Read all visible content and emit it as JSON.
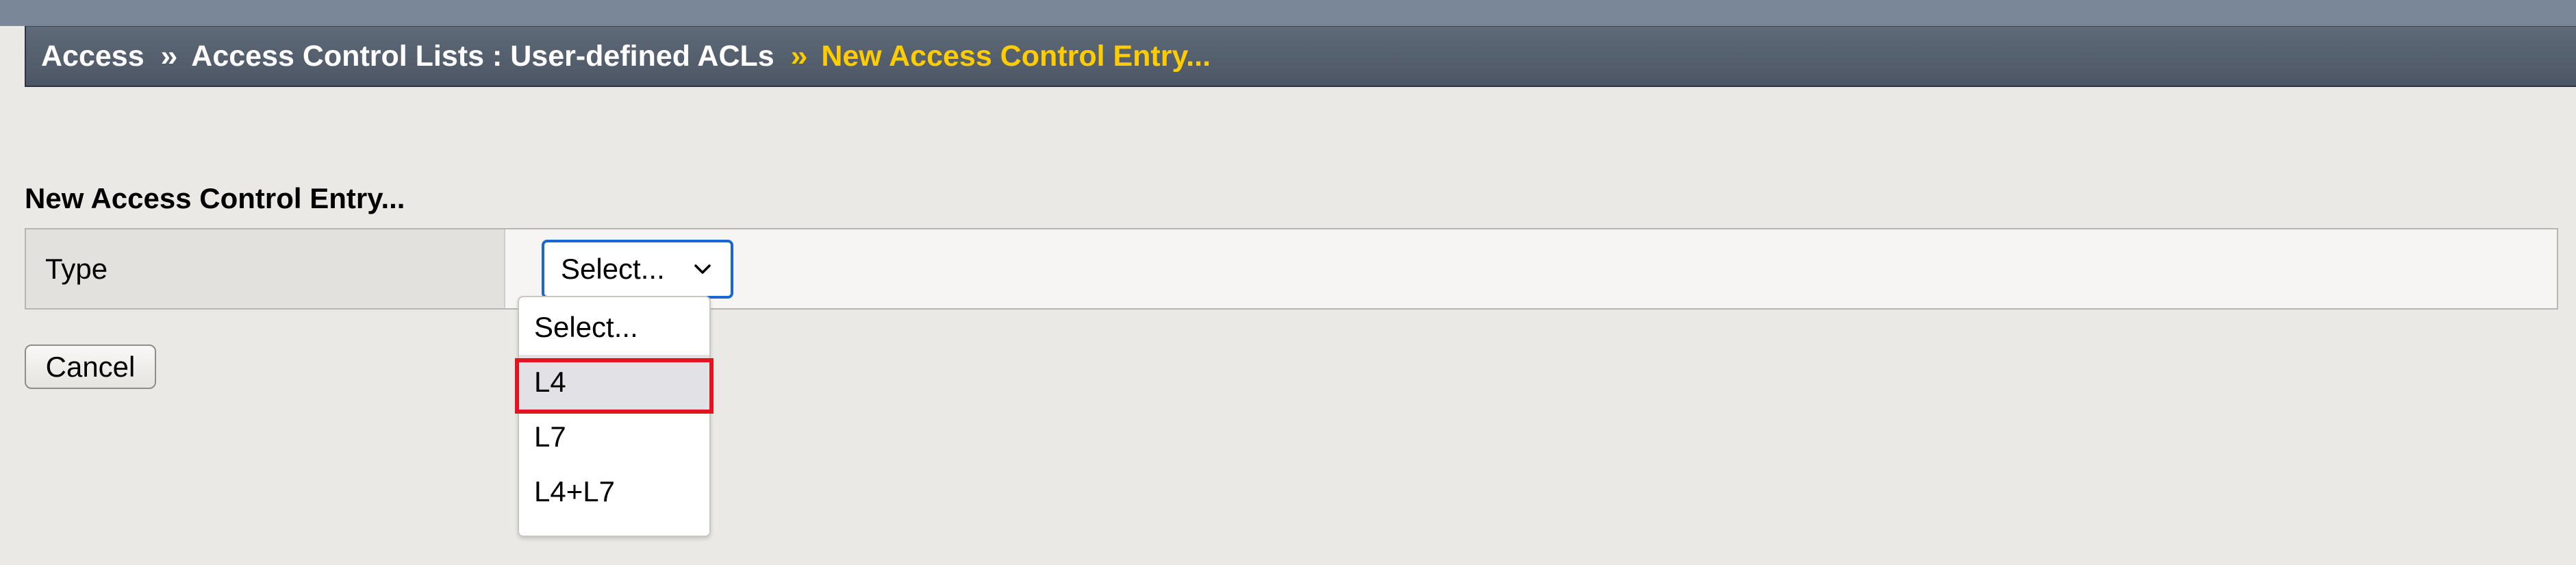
{
  "breadcrumb": {
    "items": [
      "Access",
      "Access Control Lists : User-defined ACLs"
    ],
    "separator": "››",
    "current": "New Access Control Entry..."
  },
  "form": {
    "title": "New Access Control Entry...",
    "type_label": "Type",
    "type_select": {
      "selected": "Select...",
      "options": [
        "Select...",
        "L4",
        "L7",
        "L4+L7"
      ],
      "highlighted_option": "L4"
    }
  },
  "buttons": {
    "cancel": "Cancel"
  },
  "colors": {
    "breadcrumb_bar": "#556070",
    "breadcrumb_current": "#ffcc00",
    "select_focus_border": "#1a67d2",
    "annotation_highlight": "#e0151f",
    "page_background": "#ebe9e5"
  }
}
